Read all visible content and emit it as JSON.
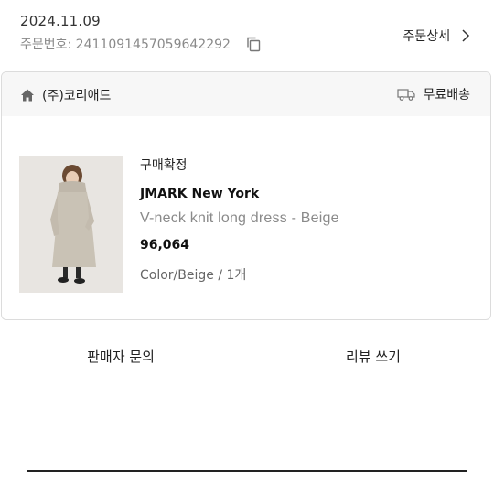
{
  "order": {
    "date": "2024.11.09",
    "number": "주문번호: 2411091457059642292",
    "detail_label": "주문상세"
  },
  "card": {
    "seller": "(주)코리애드",
    "shipping": "무료배송",
    "product": {
      "status": "구매확정",
      "brand": "JMARK New York",
      "name": "V-neck knit long dress - Beige",
      "price": "96,064",
      "option": "Color/Beige / 1개"
    }
  },
  "actions": {
    "inquiry": "판매자 문의",
    "review": "리뷰 쓰기"
  },
  "colors": {
    "background": "#ffffff",
    "header_bg": "#f7f7f7",
    "muted_text": "#8a8a8a",
    "border": "#dcdcdc"
  },
  "icons": [
    "copy-icon",
    "chevron-right-icon",
    "home-icon",
    "truck-icon"
  ]
}
